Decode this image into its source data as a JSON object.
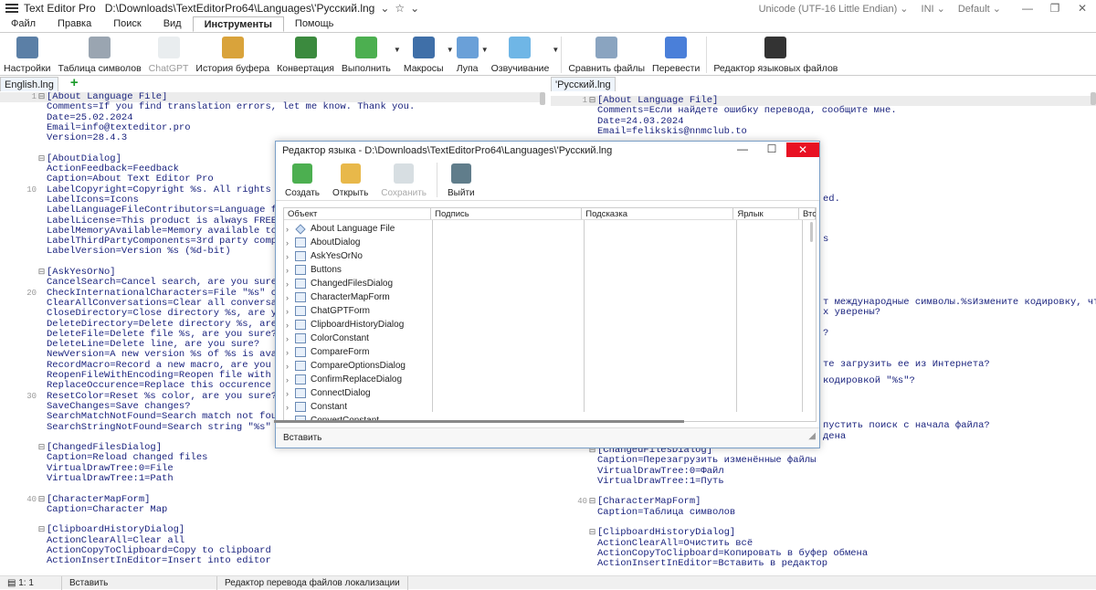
{
  "app": {
    "title": "Text Editor Pro",
    "path": "D:\\Downloads\\TextEditorPro64\\Languages\\'Русский.lng",
    "encoding": "Unicode (UTF-16 Little Endian)",
    "highlighter": "INI",
    "theme": "Default"
  },
  "menu_tabs": [
    "Файл",
    "Правка",
    "Поиск",
    "Вид",
    "Инструменты",
    "Помощь"
  ],
  "ribbon": [
    {
      "label": "Настройки",
      "icon": "settings-icon",
      "color": "#5b7fa6"
    },
    {
      "label": "Таблица символов",
      "icon": "keyboard-icon",
      "color": "#9aa5b1"
    },
    {
      "label": "ChatGPT",
      "icon": "chatgpt-icon",
      "color": "#cfd8dc",
      "disabled": true
    },
    {
      "label": "История буфера",
      "icon": "clipboard-clock-icon",
      "color": "#d9a33b"
    },
    {
      "label": "Конвертация",
      "icon": "convert-icon",
      "color": "#3b8a3e"
    },
    {
      "label": "Выполнить",
      "icon": "run-icon",
      "color": "#4caf50",
      "arrow": true
    },
    {
      "label": "Макросы",
      "icon": "film-icon",
      "color": "#3f6fa8",
      "arrow": true
    },
    {
      "label": "Лупа",
      "icon": "magnifier-icon",
      "color": "#6aa0d8",
      "arrow": true
    },
    {
      "label": "Озвучивание",
      "icon": "speech-icon",
      "color": "#6fb6e6",
      "arrow": true
    },
    {
      "label": "Сравнить файлы",
      "icon": "compare-icon",
      "color": "#8aa4c0"
    },
    {
      "label": "Перевести",
      "icon": "translate-icon",
      "color": "#4a7fd9"
    },
    {
      "label": "Редактор языковых файлов",
      "icon": "language-editor-icon",
      "color": "#333333"
    }
  ],
  "left_tab": "English.lng",
  "right_tab": "'Русский.lng",
  "left_lines": [
    {
      "n": "1",
      "f": "⊟",
      "t": "[About Language File]"
    },
    {
      "n": "",
      "f": "",
      "t": "Comments=If you find translation errors, let me know. Thank you."
    },
    {
      "n": "",
      "f": "",
      "t": "Date=25.02.2024"
    },
    {
      "n": "",
      "f": "",
      "t": "Email=info@texteditor.pro"
    },
    {
      "n": "",
      "f": "",
      "t": "Version=28.4.3"
    },
    {
      "n": "",
      "f": "",
      "t": ""
    },
    {
      "n": "",
      "f": "⊟",
      "t": "[AboutDialog]"
    },
    {
      "n": "",
      "f": "",
      "t": "ActionFeedback=Feedback"
    },
    {
      "n": "",
      "f": "",
      "t": "Caption=About Text Editor Pro"
    },
    {
      "n": "10",
      "f": "",
      "t": "LabelCopyright=Copyright %s. All rights reserved."
    },
    {
      "n": "",
      "f": "",
      "t": "LabelIcons=Icons"
    },
    {
      "n": "",
      "f": "",
      "t": "LabelLanguageFileContributors=Language file cont"
    },
    {
      "n": "",
      "f": "",
      "t": "LabelLicense=This product is always FREE for you"
    },
    {
      "n": "",
      "f": "",
      "t": "LabelMemoryAvailable=Memory available to Windows"
    },
    {
      "n": "",
      "f": "",
      "t": "LabelThirdPartyComponents=3rd party components"
    },
    {
      "n": "",
      "f": "",
      "t": "LabelVersion=Version %s (%d-bit)"
    },
    {
      "n": "",
      "f": "",
      "t": ""
    },
    {
      "n": "",
      "f": "⊟",
      "t": "[AskYesOrNo]"
    },
    {
      "n": "",
      "f": "",
      "t": "CancelSearch=Cancel search, are you sure?"
    },
    {
      "n": "20",
      "f": "",
      "t": "CheckInternationalCharacters=File \"%s\" contains"
    },
    {
      "n": "",
      "f": "",
      "t": "ClearAllConversations=Clear all conversations, a"
    },
    {
      "n": "",
      "f": "",
      "t": "CloseDirectory=Close directory %s, are you sure"
    },
    {
      "n": "",
      "f": "",
      "t": "DeleteDirectory=Delete directory %s, are you su"
    },
    {
      "n": "",
      "f": "",
      "t": "DeleteFile=Delete file %s, are you sure?"
    },
    {
      "n": "",
      "f": "",
      "t": "DeleteLine=Delete line, are you sure?"
    },
    {
      "n": "",
      "f": "",
      "t": "NewVersion=A new version %s of %s is available.%"
    },
    {
      "n": "",
      "f": "",
      "t": "RecordMacro=Record a new macro, are you sure?"
    },
    {
      "n": "",
      "f": "",
      "t": "ReopenFileWithEncoding=Reopen file with \"%s\" en"
    },
    {
      "n": "",
      "f": "",
      "t": "ReplaceOccurence=Replace this occurence of \"%s\""
    },
    {
      "n": "30",
      "f": "",
      "t": "ResetColor=Reset %s color, are you sure?"
    },
    {
      "n": "",
      "f": "",
      "t": "SaveChanges=Save changes?"
    },
    {
      "n": "",
      "f": "",
      "t": "SearchMatchNotFound=Search match not found.%sRe"
    },
    {
      "n": "",
      "f": "",
      "t": "SearchStringNotFound=Search string \"%s\" not fou"
    },
    {
      "n": "",
      "f": "",
      "t": ""
    },
    {
      "n": "",
      "f": "⊟",
      "t": "[ChangedFilesDialog]"
    },
    {
      "n": "",
      "f": "",
      "t": "Caption=Reload changed files"
    },
    {
      "n": "",
      "f": "",
      "t": "VirtualDrawTree:0=File"
    },
    {
      "n": "",
      "f": "",
      "t": "VirtualDrawTree:1=Path"
    },
    {
      "n": "",
      "f": "",
      "t": ""
    },
    {
      "n": "40",
      "f": "⊟",
      "t": "[CharacterMapForm]"
    },
    {
      "n": "",
      "f": "",
      "t": "Caption=Character Map"
    },
    {
      "n": "",
      "f": "",
      "t": ""
    },
    {
      "n": "",
      "f": "⊟",
      "t": "[ClipboardHistoryDialog]"
    },
    {
      "n": "",
      "f": "",
      "t": "ActionClearAll=Clear all"
    },
    {
      "n": "",
      "f": "",
      "t": "ActionCopyToClipboard=Copy to clipboard"
    },
    {
      "n": "",
      "f": "",
      "t": "ActionInsertInEditor=Insert into editor"
    }
  ],
  "right_lines_top": [
    {
      "n": "1",
      "f": "⊟",
      "t": "[About Language File]"
    },
    {
      "n": "",
      "f": "",
      "t": "Comments=Если найдете ошибку перевода, сообщите мне."
    },
    {
      "n": "",
      "f": "",
      "t": "Date=24.03.2024"
    },
    {
      "n": "",
      "f": "",
      "t": "Email=felikskis@nnmclub.to"
    }
  ],
  "right_fragments": [
    "ed.",
    "s",
    "т международные символы.%sИзмените кодировку, чтобы сохра",
    "х уверены?",
    "?",
    "те загрузить ее из Интернета?",
    "кодировкой \"%s\"?",
    "пустить поиск с начала файла?",
    "дена"
  ],
  "right_lines_bottom": [
    {
      "n": "",
      "f": "⊟",
      "t": "[ChangedFilesDialog]"
    },
    {
      "n": "",
      "f": "",
      "t": "Caption=Перезагрузить изменённые файлы"
    },
    {
      "n": "",
      "f": "",
      "t": "VirtualDrawTree:0=Файл"
    },
    {
      "n": "",
      "f": "",
      "t": "VirtualDrawTree:1=Путь"
    },
    {
      "n": "",
      "f": "",
      "t": ""
    },
    {
      "n": "40",
      "f": "⊟",
      "t": "[CharacterMapForm]"
    },
    {
      "n": "",
      "f": "",
      "t": "Caption=Таблица символов"
    },
    {
      "n": "",
      "f": "",
      "t": ""
    },
    {
      "n": "",
      "f": "⊟",
      "t": "[ClipboardHistoryDialog]"
    },
    {
      "n": "",
      "f": "",
      "t": "ActionClearAll=Очистить всё"
    },
    {
      "n": "",
      "f": "",
      "t": "ActionCopyToClipboard=Копировать в буфер обмена"
    },
    {
      "n": "",
      "f": "",
      "t": "ActionInsertInEditor=Вставить в редактор"
    }
  ],
  "status": {
    "pos": "1: 1",
    "mode": "Вставить",
    "message": "Редактор перевода файлов локализации"
  },
  "dialog": {
    "title": "Редактор языка - D:\\Downloads\\TextEditorPro64\\Languages\\'Русский.lng",
    "tools": [
      {
        "label": "Создать",
        "icon": "new-file-icon",
        "color": "#4caf50"
      },
      {
        "label": "Открыть",
        "icon": "open-folder-icon",
        "color": "#e8b84a"
      },
      {
        "label": "Сохранить",
        "icon": "save-icon",
        "color": "#b0bec5",
        "disabled": true
      },
      {
        "label": "Выйти",
        "icon": "exit-icon",
        "color": "#607d8b"
      }
    ],
    "columns": [
      "Объект",
      "Подпись",
      "Подсказка",
      "Ярлык",
      "Вто"
    ],
    "tree": [
      "About Language File",
      "AboutDialog",
      "AskYesOrNo",
      "Buttons",
      "ChangedFilesDialog",
      "CharacterMapForm",
      "ChatGPTForm",
      "ClipboardHistoryDialog",
      "ColorConstant",
      "CompareForm",
      "CompareOptionsDialog",
      "ConfirmReplaceDialog",
      "ConnectDialog",
      "Constant",
      "ConvertConstant"
    ],
    "status": "Вставить"
  }
}
